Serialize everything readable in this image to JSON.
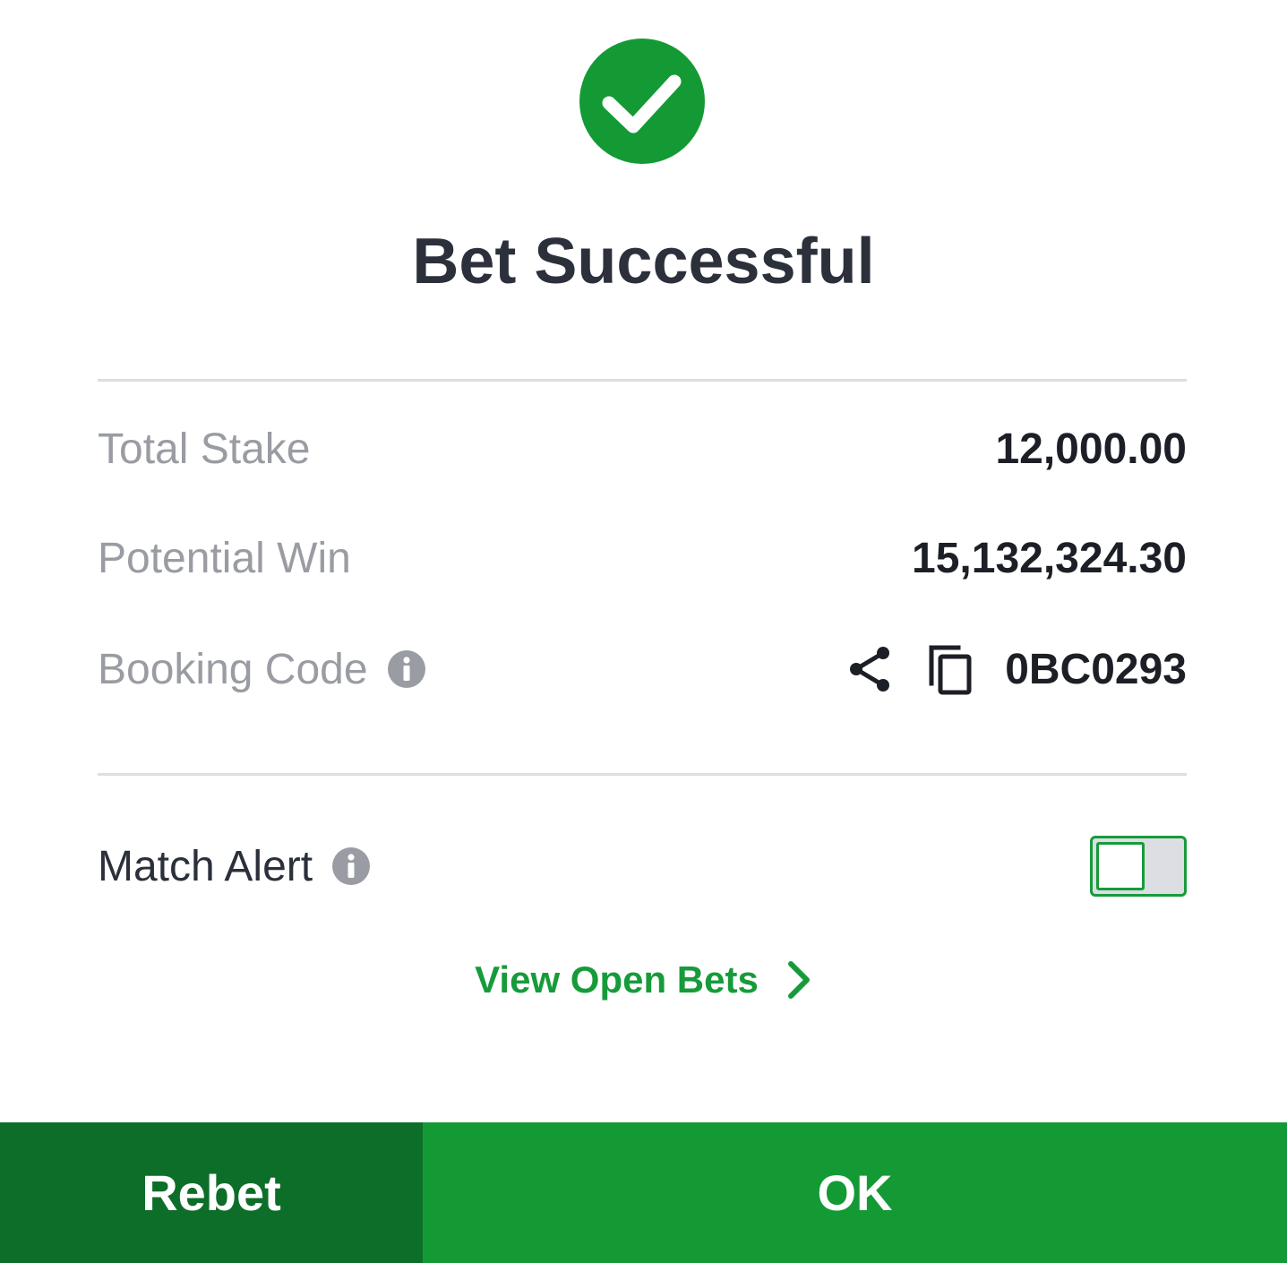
{
  "title": "Bet Successful",
  "summary": {
    "total_stake_label": "Total Stake",
    "total_stake_value": "12,000.00",
    "potential_win_label": "Potential Win",
    "potential_win_value": "15,132,324.30",
    "booking_code_label": "Booking Code",
    "booking_code_value": "0BC0293"
  },
  "match_alert": {
    "label": "Match Alert",
    "enabled": false
  },
  "links": {
    "view_open_bets": "View Open Bets"
  },
  "footer": {
    "rebet_label": "Rebet",
    "ok_label": "OK"
  },
  "colors": {
    "brand_green": "#149a35",
    "dark_green": "#0d6e29",
    "muted_text": "#9a9ca3",
    "title_text": "#2b303b"
  },
  "icons": {
    "success": "check-circle-icon",
    "info": "info-icon",
    "share": "share-icon",
    "copy": "copy-icon",
    "chevron": "chevron-right-icon"
  }
}
